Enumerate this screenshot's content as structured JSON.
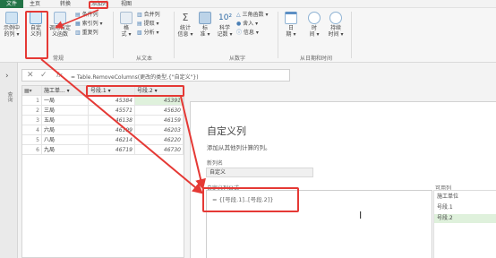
{
  "menu": [
    "文件",
    "主页",
    "转换",
    "添加列",
    "视图"
  ],
  "ribbon": {
    "custom_fn_btn": [
      "示例中",
      "的列 ▾"
    ],
    "custom_col_btn": [
      "自定",
      "义列"
    ],
    "invoke_fn_btn": [
      "调用自定",
      "义函数"
    ],
    "general_small": [
      "条件列",
      "索引列 ▾",
      "重复列"
    ],
    "general_label": "常规",
    "format_btn": [
      "格",
      "式 ▾"
    ],
    "text_small": [
      "合并列",
      "提取 ▾",
      "分析 ▾"
    ],
    "text_label": "从文本",
    "stats_btn": [
      "统计",
      "信息 ▾"
    ],
    "standard_btn": [
      "标",
      "准 ▾"
    ],
    "sci_btn": [
      "科学",
      "记数 ▾"
    ],
    "number_small": [
      "三角函数 ▾",
      "舍入 ▾",
      "信息 ▾"
    ],
    "number_label": "从数字",
    "date_btn": [
      "日",
      "期 ▾"
    ],
    "time_btn": [
      "时",
      "间 ▾"
    ],
    "duration_btn": [
      "持续",
      "时间 ▾"
    ],
    "datetime_label": "从日期和时间",
    "icon_sigma": "Σ",
    "icon_pow": "10²"
  },
  "sidebar": {
    "arrow": "›",
    "label": "查询"
  },
  "formula_bar": {
    "cancel": "✕",
    "confirm": "✓",
    "fx": "fx",
    "formula": "= Table.RemoveColumns(更改的类型,{\"自定义\"})"
  },
  "grid": {
    "headers": [
      "施工单... ▾",
      "号段.1 ▾",
      "号段.2 ▾"
    ],
    "rows": [
      {
        "n": "1",
        "unit": "一局",
        "a": "45384",
        "b": "45391"
      },
      {
        "n": "2",
        "unit": "三局",
        "a": "45571",
        "b": "45630"
      },
      {
        "n": "3",
        "unit": "五局",
        "a": "46138",
        "b": "46159"
      },
      {
        "n": "4",
        "unit": "六局",
        "a": "46199",
        "b": "46203"
      },
      {
        "n": "5",
        "unit": "八局",
        "a": "46214",
        "b": "46220"
      },
      {
        "n": "6",
        "unit": "九局",
        "a": "46719",
        "b": "46730"
      }
    ]
  },
  "dialog": {
    "title": "自定义列",
    "subtitle": "添加从其他列计算的列。",
    "name_label": "新列名",
    "name_value": "自定义",
    "formula_label": "自定义列公式",
    "formula": "= {[号段.1]..[号段.2]}",
    "cursor": "I",
    "available_label": "可用列",
    "available": [
      "施工单位",
      "号段.1",
      "号段.2"
    ]
  },
  "colors": {
    "annotation_red": "#e53935",
    "file_tab": "#217346",
    "highlight_green": "#dff1dc"
  }
}
